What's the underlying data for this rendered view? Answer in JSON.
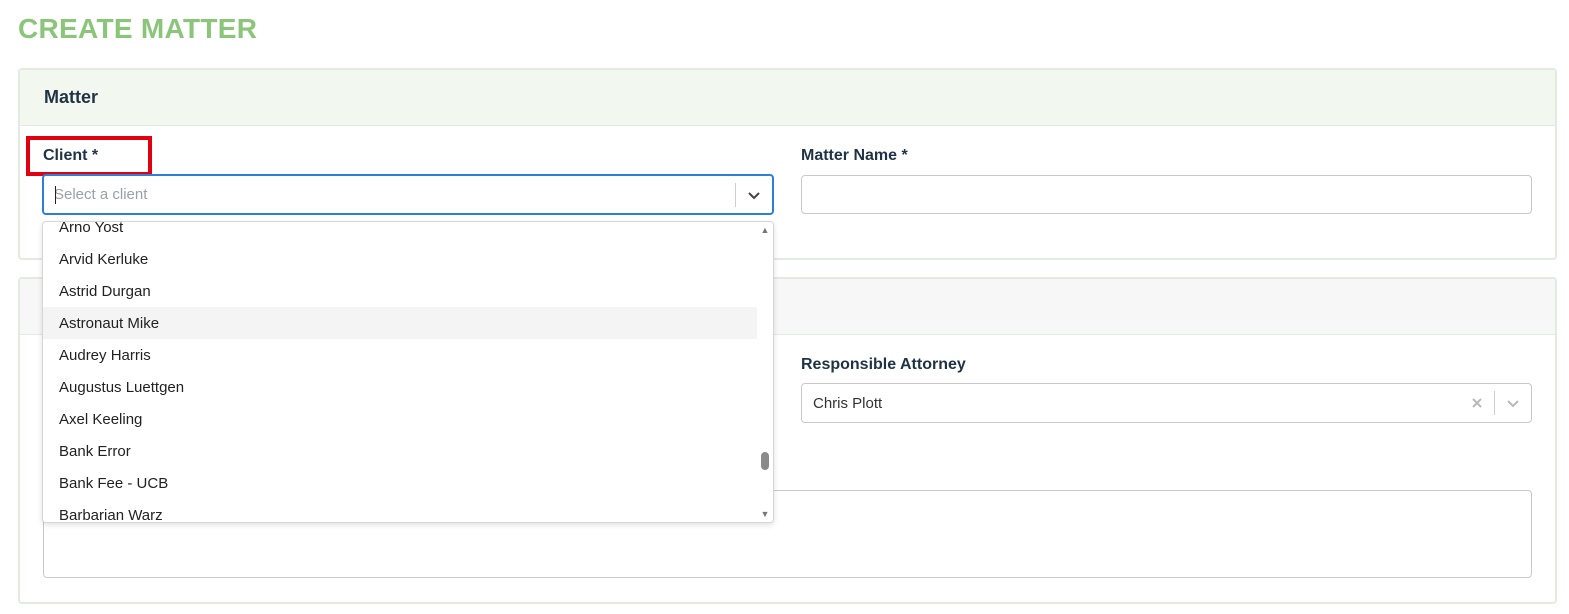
{
  "page": {
    "title": "CREATE MATTER"
  },
  "matter_card": {
    "header": "Matter",
    "client": {
      "label": "Client *",
      "placeholder": "Select a client"
    },
    "matter_name": {
      "label": "Matter Name *",
      "value": ""
    }
  },
  "second_card": {
    "header": "",
    "responsible_attorney": {
      "label": "Responsible Attorney",
      "value": "Chris Plott"
    },
    "notes_value": ""
  },
  "client_dropdown": {
    "options": [
      "Arno Yost",
      "Arvid Kerluke",
      "Astrid Durgan",
      "Astronaut Mike",
      "Audrey Harris",
      "Augustus Luettgen",
      "Axel Keeling",
      "Bank Error",
      "Bank Fee - UCB",
      "Barbarian Warz"
    ],
    "focused_option": "Astronaut Mike"
  },
  "colors": {
    "title_green": "#8bc57a",
    "focus_blue": "#2f7fd3",
    "highlight_red": "#e0000f",
    "header_green_bg": "#f2f8ef"
  },
  "icons": {
    "client_dropdown": "chevron-down-icon",
    "attorney_clear": "close-icon",
    "attorney_dropdown": "chevron-down-icon"
  }
}
